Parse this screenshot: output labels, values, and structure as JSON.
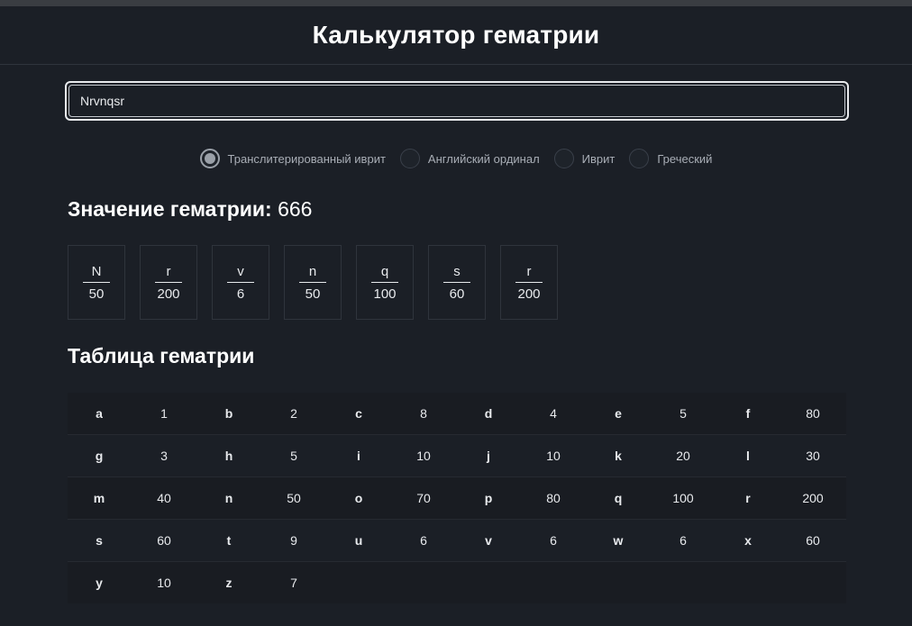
{
  "app": {
    "title": "Калькулятор гематрии"
  },
  "input": {
    "value": "Nrvnqsr",
    "placeholder": ""
  },
  "modes": [
    {
      "label": "Транслитерированный иврит",
      "checked": true
    },
    {
      "label": "Английский ординал",
      "checked": false
    },
    {
      "label": "Иврит",
      "checked": false
    },
    {
      "label": "Греческий",
      "checked": false
    }
  ],
  "result": {
    "label": "Значение гематрии:",
    "value": "666"
  },
  "letters": [
    {
      "char": "N",
      "value": "50"
    },
    {
      "char": "r",
      "value": "200"
    },
    {
      "char": "v",
      "value": "6"
    },
    {
      "char": "n",
      "value": "50"
    },
    {
      "char": "q",
      "value": "100"
    },
    {
      "char": "s",
      "value": "60"
    },
    {
      "char": "r",
      "value": "200"
    }
  ],
  "table": {
    "title": "Таблица гематрии",
    "rows": [
      [
        [
          "a",
          "1"
        ],
        [
          "b",
          "2"
        ],
        [
          "c",
          "8"
        ],
        [
          "d",
          "4"
        ],
        [
          "e",
          "5"
        ],
        [
          "f",
          "80"
        ]
      ],
      [
        [
          "g",
          "3"
        ],
        [
          "h",
          "5"
        ],
        [
          "i",
          "10"
        ],
        [
          "j",
          "10"
        ],
        [
          "k",
          "20"
        ],
        [
          "l",
          "30"
        ]
      ],
      [
        [
          "m",
          "40"
        ],
        [
          "n",
          "50"
        ],
        [
          "o",
          "70"
        ],
        [
          "p",
          "80"
        ],
        [
          "q",
          "100"
        ],
        [
          "r",
          "200"
        ]
      ],
      [
        [
          "s",
          "60"
        ],
        [
          "t",
          "9"
        ],
        [
          "u",
          "6"
        ],
        [
          "v",
          "6"
        ],
        [
          "w",
          "6"
        ],
        [
          "x",
          "60"
        ]
      ],
      [
        [
          "y",
          "10"
        ],
        [
          "z",
          "7"
        ]
      ]
    ]
  }
}
